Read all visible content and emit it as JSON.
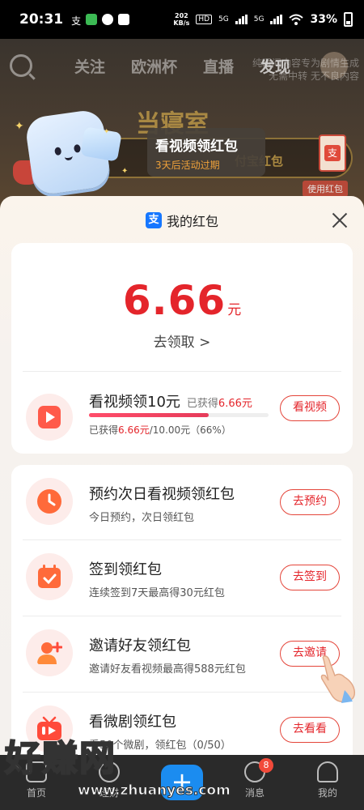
{
  "status_bar": {
    "time": "20:31",
    "speed_value": "202",
    "speed_unit": "KB/s",
    "hd_label": "HD",
    "net1": "5G",
    "net2": "5G",
    "battery": "33%"
  },
  "background_page": {
    "nav_tabs": [
      "关注",
      "欧洲杯",
      "直播",
      "发现"
    ],
    "active_tab": "发现",
    "overlay_text": "纯瞬间内容专为剧情生成 无需中转 无不良内容",
    "headline": "当寝室",
    "banner_text": "付宝红包",
    "use_redpacket_label": "使用红包",
    "redpacket_glyph": "支"
  },
  "video_toast": {
    "title": "看视频领红包",
    "subtitle": "3天后活动过期"
  },
  "sheet": {
    "logo_glyph": "支",
    "title": "我的红包",
    "close_icon": "close-icon"
  },
  "balance": {
    "amount": "6.66",
    "unit": "元",
    "claim_label": "去领取 >"
  },
  "video_task": {
    "title": "看视频领10元",
    "earned_prefix": "已获得",
    "earned_value": "6.66元",
    "progress_prefix": "已获得",
    "progress_value": "6.66元",
    "progress_rest": "/10.00元（66%）",
    "progress_fraction": 0.666,
    "button": "看视频",
    "icon": "play-icon"
  },
  "tasks": [
    {
      "title": "预约次日看视频领红包",
      "subtitle": "今日预约，次日领红包",
      "button": "去预约",
      "icon": "clock-icon"
    },
    {
      "title": "签到领红包",
      "subtitle": "连续签到7天最高得30元红包",
      "button": "去签到",
      "icon": "calendar-check-icon"
    },
    {
      "title": "邀请好友领红包",
      "subtitle": "邀请好友看视频最高得588元红包",
      "button": "去邀请",
      "icon": "add-friend-icon"
    },
    {
      "title": "看微剧领红包",
      "subtitle": "看50个微剧，领红包（0/50）",
      "button": "去看看",
      "icon": "tv-icon"
    }
  ],
  "tab_bar": {
    "items": [
      "首页",
      "理财",
      "",
      "消息",
      "我的"
    ],
    "plus_label": "+",
    "message_badge": "8"
  },
  "watermark": {
    "text": "好赚网",
    "url": "www.zhuanyes.com"
  },
  "colors": {
    "accent_red": "#e4252b",
    "alipay_blue": "#1677ff",
    "toast_orange": "#f0a23a"
  }
}
